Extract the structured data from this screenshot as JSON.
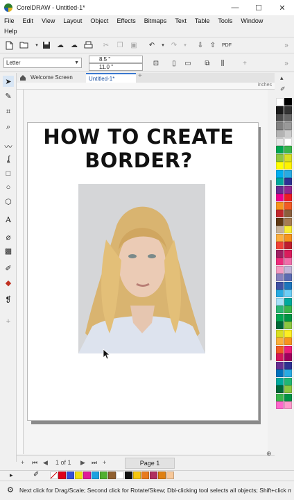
{
  "window": {
    "title": "CorelDRAW - Untitled-1*",
    "minimize": "—",
    "maximize": "☐",
    "close": "✕"
  },
  "menu": {
    "row1": [
      "File",
      "Edit",
      "View",
      "Layout",
      "Object",
      "Effects",
      "Bitmaps",
      "Text",
      "Table",
      "Tools",
      "Window"
    ],
    "row2": [
      "Help"
    ]
  },
  "propbar": {
    "page_size": "Letter",
    "width": "8.5 \"",
    "height": "11.0 \""
  },
  "tabs": {
    "welcome": "Welcome Screen",
    "document": "Untitled-1*",
    "add": "+"
  },
  "ruler": {
    "unit": "inches"
  },
  "canvas": {
    "headline_line1": "HOW TO CREATE",
    "headline_line2": "BORDER?"
  },
  "pagenav": {
    "page_count": "1  of  1",
    "page_tab": "Page 1"
  },
  "status": {
    "message": "Next click for Drag/Scale; Second click for Rotate/Skew; Dbl-clicking tool selects all objects; Shift+click mu"
  },
  "colors": {
    "accent": "#3a78d0",
    "palette": [
      "#ffffff",
      "#000000",
      "#1a1a1a",
      "#333333",
      "#4d4d4d",
      "#666666",
      "#808080",
      "#999999",
      "#b3b3b3",
      "#cccccc",
      "#e6e6e6",
      "#ffffff",
      "#00a651",
      "#39b54a",
      "#8dc63f",
      "#d7df23",
      "#ffff00",
      "#fff200",
      "#00aeef",
      "#29abe2",
      "#00a79d",
      "#2e3192",
      "#662d91",
      "#92278f",
      "#ec008c",
      "#ed1c24",
      "#f7941d",
      "#f15a24",
      "#c1272d",
      "#8b5e3c",
      "#603913",
      "#a67c52",
      "#c7b299",
      "#f9ed32",
      "#fbb040",
      "#f7941d",
      "#ef4136",
      "#be1e2d",
      "#9e1f63",
      "#da1c5c",
      "#ee2a7b",
      "#f06eaa",
      "#f49ac1",
      "#c2b5d8",
      "#8781bd",
      "#5b6cb2",
      "#3f51a3",
      "#1c75bc",
      "#27aae1",
      "#6dcff6",
      "#a6e1f8",
      "#00a99d",
      "#2bb673",
      "#39b54a",
      "#00a651",
      "#009444",
      "#006838",
      "#8cc63f",
      "#d9e021",
      "#fcee21",
      "#fbb03b",
      "#f7931e",
      "#f15a24",
      "#ed1e79",
      "#d4145a",
      "#9e005d",
      "#662d91",
      "#2e3192",
      "#0071bc",
      "#29abe2",
      "#00a99d",
      "#22b573",
      "#006837",
      "#8cc63f",
      "#39b54a",
      "#009245",
      "#ff66cc",
      "#ff99cc"
    ],
    "docpalette": [
      "#e0001a",
      "#3550d8",
      "#f0e010",
      "#e01a9a",
      "#1aa0e0",
      "#50b030",
      "#906030",
      "#ffffff",
      "#111111",
      "#f6c60e",
      "#e87b1e",
      "#b03060",
      "#e08010",
      "#f7c89a"
    ]
  }
}
